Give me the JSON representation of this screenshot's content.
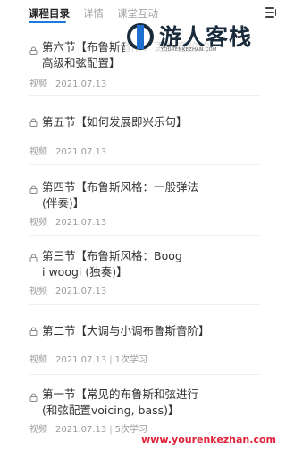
{
  "tabs": [
    {
      "label": "课程目录",
      "active": true
    },
    {
      "label": "详情",
      "active": false
    },
    {
      "label": "课堂互动",
      "active": false
    }
  ],
  "icons": {
    "menu": "list-menu-icon",
    "lock": "lock-icon"
  },
  "colors": {
    "accent": "#1f7ae0",
    "text": "#333333",
    "meta": "#9b9b9b",
    "watermark_url": "#e0233b"
  },
  "lessons": [
    {
      "title": "第六节【布鲁斯音阶：更多音阶的高级和弦配置】",
      "type": "视频",
      "date": "2021.07.13",
      "views": ""
    },
    {
      "title": "第五节【如何发展即兴乐句】",
      "type": "视频",
      "date": "2021.07.13",
      "views": ""
    },
    {
      "title": "第四节【布鲁斯风格：一般弹法(伴奏)】",
      "type": "视频",
      "date": "2021.07.13",
      "views": ""
    },
    {
      "title": "第三节【布鲁斯风格：Boogi woogi (独奏)】",
      "type": "视频",
      "date": "2021.07.13",
      "views": ""
    },
    {
      "title": "第二节【大调与小调布鲁斯音阶】",
      "type": "视频",
      "date": "2021.07.13",
      "views": "1次学习"
    },
    {
      "title": "第一节【常见的布鲁斯和弦进行(和弦配置voicing, bass)】",
      "type": "视频",
      "date": "2021.07.13",
      "views": "5次学习"
    }
  ],
  "watermark": {
    "name": "游人客栈",
    "sub": "YOURENKEZHAN.COM",
    "url": "www.yourenkezhan.com"
  }
}
